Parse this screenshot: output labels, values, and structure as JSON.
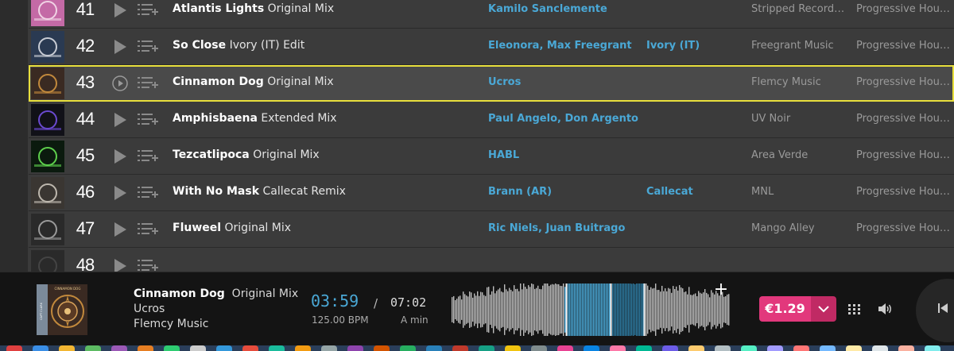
{
  "tracks": [
    {
      "rank": "41",
      "title": "Atlantis Lights",
      "mix": "Original Mix",
      "artists": "Kamilo Sanclemente",
      "remixers": "",
      "label": "Stripped Record…",
      "genre": "Progressive Hou…",
      "selected": false,
      "cover_colors": [
        "#c46aa6",
        "#f0d3e4"
      ]
    },
    {
      "rank": "42",
      "title": "So Close",
      "mix": "Ivory (IT) Edit",
      "artists": "Eleonora, Max Freegrant",
      "remixers": "Ivory (IT)",
      "label": "Freegrant Music",
      "genre": "Progressive Hou…",
      "selected": false,
      "cover_colors": [
        "#2a3a52",
        "#c8ccd4"
      ]
    },
    {
      "rank": "43",
      "title": "Cinnamon Dog",
      "mix": "Original Mix",
      "artists": "Ucros",
      "remixers": "",
      "label": "Flemcy Music",
      "genre": "Progressive Hou…",
      "selected": true,
      "cover_colors": [
        "#3a2a22",
        "#c2893c"
      ]
    },
    {
      "rank": "44",
      "title": "Amphisbaena",
      "mix": "Extended Mix",
      "artists": "Paul Angelo, Don Argento",
      "remixers": "",
      "label": "UV Noir",
      "genre": "Progressive Hou…",
      "selected": false,
      "cover_colors": [
        "#111118",
        "#6a4ad0"
      ]
    },
    {
      "rank": "45",
      "title": "Tezcatlipoca",
      "mix": "Original Mix",
      "artists": "HABL",
      "remixers": "",
      "label": "Area Verde",
      "genre": "Progressive Hou…",
      "selected": false,
      "cover_colors": [
        "#0b1a0e",
        "#5ed04c"
      ]
    },
    {
      "rank": "46",
      "title": "With No Mask",
      "mix": "Callecat Remix",
      "artists": "Brann (AR)",
      "remixers": "Callecat",
      "label": "MNL",
      "genre": "Progressive Hou…",
      "selected": false,
      "cover_colors": [
        "#3a3632",
        "#bdb7ad"
      ]
    },
    {
      "rank": "47",
      "title": "Fluweel",
      "mix": "Original Mix",
      "artists": "Ric Niels, Juan Buitrago",
      "remixers": "",
      "label": "Mango Alley",
      "genre": "Progressive Hou…",
      "selected": false,
      "cover_colors": [
        "#2a2a2a",
        "#9a9a9a"
      ]
    },
    {
      "rank": "48",
      "title": "",
      "mix": "",
      "artists": "",
      "remixers": "",
      "label": "",
      "genre": "",
      "selected": false,
      "cover_colors": [
        "#2a2a2a",
        "#444444"
      ]
    }
  ],
  "player": {
    "title": "Cinnamon Dog",
    "mix": "Original Mix",
    "artist": "Ucros",
    "label": "Flemcy Music",
    "elapsed": "03:59",
    "separator": "/",
    "total": "07:02",
    "bpm": "125.00 BPM",
    "key": "A min",
    "price": "€1.29",
    "progress_fraction": 0.57,
    "add_label": "+",
    "cover_text": "CINNAMON DOG",
    "cover_side_text": "CAPT CLARK"
  },
  "icons": {
    "play": "play-icon",
    "queue": "add-to-queue-icon",
    "grid": "grid-icon",
    "volume": "volume-icon",
    "prev": "skip-previous-icon",
    "dropdown": "chevron-down-icon"
  },
  "colors": {
    "accent_blue": "#4aa8d6",
    "price_pink": "#e2387c",
    "selection_yellow": "#e8df3c"
  },
  "dock_colors": [
    "#e04040",
    "#3a8ee6",
    "#f2b632",
    "#5dbb63",
    "#9b59b6",
    "#e67e22",
    "#2ecc71",
    "#cccccc",
    "#3498db",
    "#e74c3c",
    "#1abc9c",
    "#f39c12",
    "#95a5a6",
    "#8e44ad",
    "#d35400",
    "#27ae60",
    "#2980b9",
    "#c0392b",
    "#16a085",
    "#f1c40f",
    "#7f8c8d",
    "#e84393",
    "#0984e3",
    "#fd79a8",
    "#00b894",
    "#6c5ce7",
    "#fdcb6e",
    "#b2bec3",
    "#55efc4",
    "#a29bfe",
    "#ff7675",
    "#74b9ff",
    "#ffeaa7",
    "#dfe6e9",
    "#fab1a0",
    "#81ecec"
  ]
}
